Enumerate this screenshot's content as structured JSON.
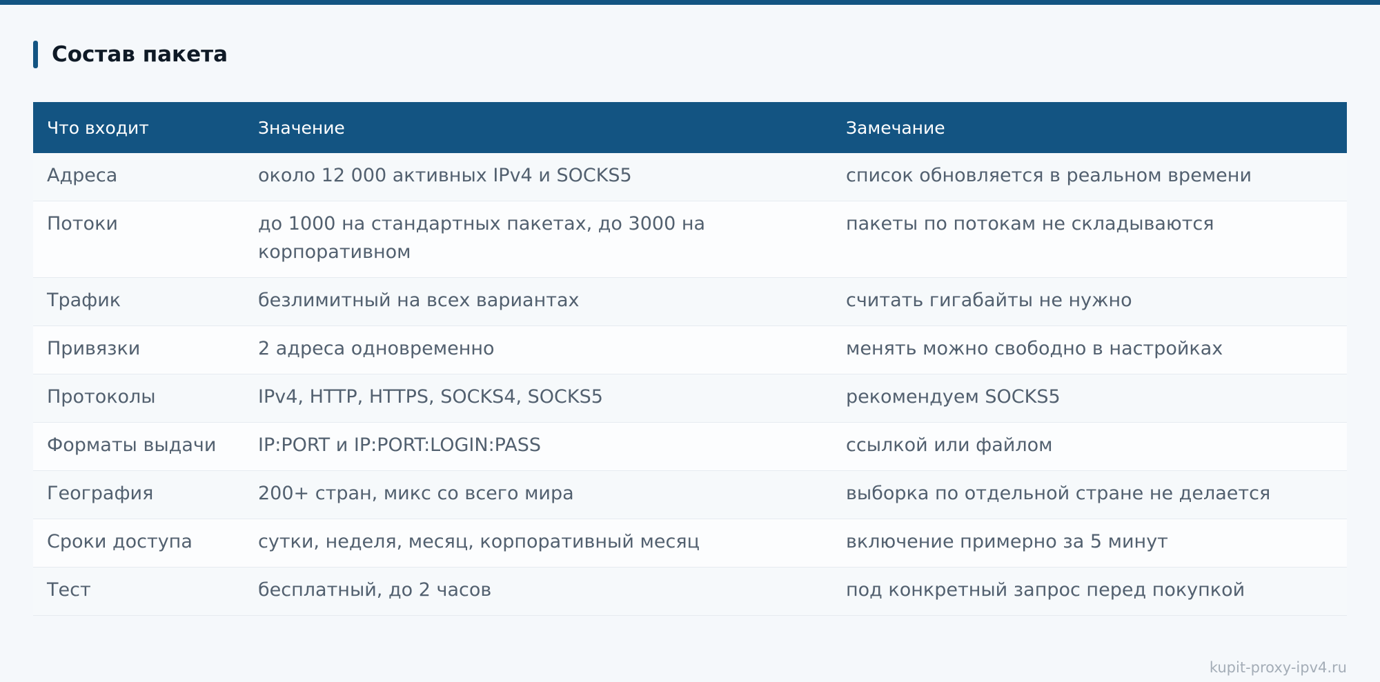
{
  "section": {
    "title": "Состав пакета"
  },
  "table": {
    "headers": [
      "Что входит",
      "Значение",
      "Замечание"
    ],
    "rows": [
      [
        "Адреса",
        "около 12 000 активных IPv4 и SOCKS5",
        "список обновляется в реальном времени"
      ],
      [
        "Потоки",
        "до 1000 на стандартных пакетах, до 3000 на корпоративном",
        "пакеты по потокам не складываются"
      ],
      [
        "Трафик",
        "безлимитный на всех вариантах",
        "считать гигабайты не нужно"
      ],
      [
        "Привязки",
        "2 адреса одновременно",
        "менять можно свободно в настройках"
      ],
      [
        "Протоколы",
        "IPv4, HTTP, HTTPS, SOCKS4, SOCKS5",
        "рекомендуем SOCKS5"
      ],
      [
        "Форматы выдачи",
        "IP:PORT и IP:PORT:LOGIN:PASS",
        "ссылкой или файлом"
      ],
      [
        "География",
        "200+ стран, микс со всего мира",
        "выборка по отдельной стране не делается"
      ],
      [
        "Сроки доступа",
        "сутки, неделя, месяц, корпоративный месяц",
        "включение примерно за 5 минут"
      ],
      [
        "Тест",
        "бесплатный, до 2 часов",
        "под конкретный запрос перед покупкой"
      ]
    ]
  },
  "footer": {
    "watermark": "kupit-proxy-ipv4.ru"
  },
  "colors": {
    "accent": "#135482",
    "text": "#52606f",
    "heading": "#0f1a26"
  }
}
